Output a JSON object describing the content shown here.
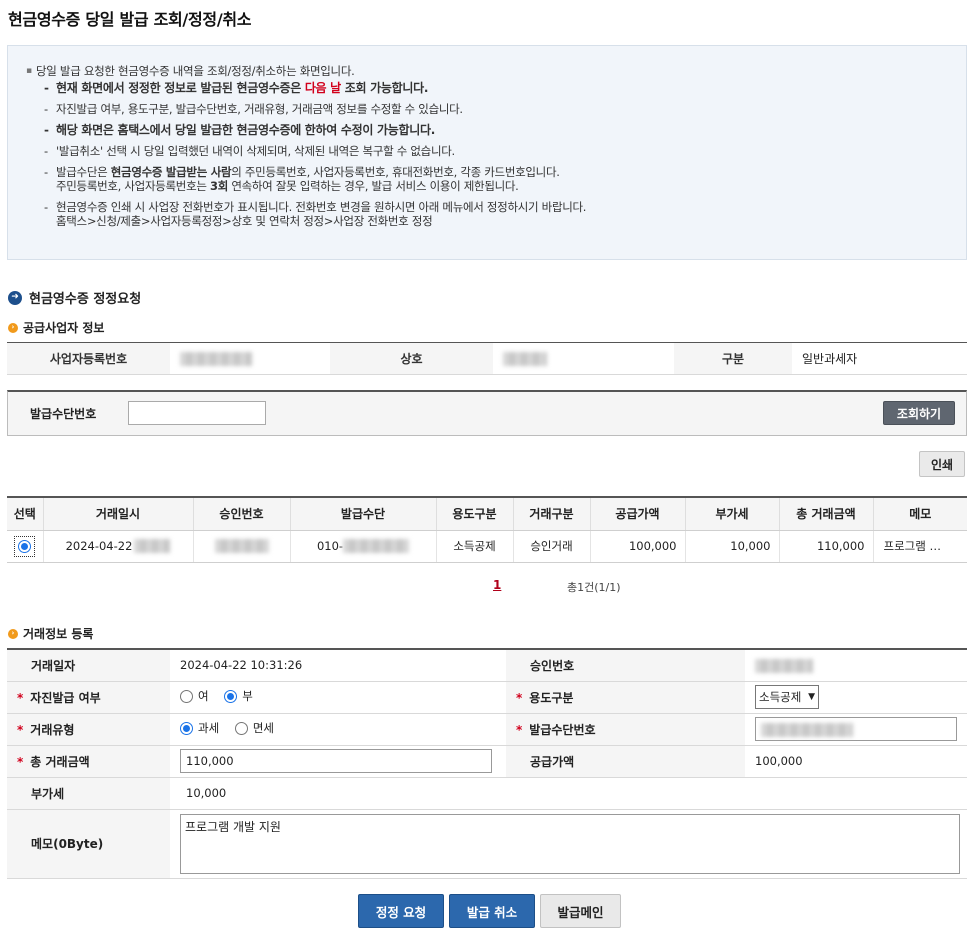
{
  "page": {
    "title": "현금영수증 당일 발급 조회/정정/취소"
  },
  "notice": {
    "intro": "당일 발급 요청한 현금영수증 내역을 조회/정정/취소하는 화면입니다.",
    "line1_a": "현재 화면에서 정정한 정보로 발급된 현금영수증은 ",
    "line1_b": "다음 날",
    "line1_c": " 조회 가능합니다.",
    "line2": "자진발급 여부, 용도구분, 발급수단번호, 거래유형, 거래금액 정보를 수정할 수 있습니다.",
    "line3": "해당 화면은 홈택스에서 당일 발급한 현금영수증에 한하여 수정이 가능합니다.",
    "line4": "'발급취소' 선택 시 당일 입력했던 내역이 삭제되며, 삭제된 내역은 복구할 수 없습니다.",
    "line5_a": "발급수단은 ",
    "line5_b": "현금영수증 발급받는 사람",
    "line5_c": "의 주민등록번호, 사업자등록번호, 휴대전화번호, 각종 카드번호입니다.",
    "line5_d": "주민등록번호, 사업자등록번호는 ",
    "line5_e": "3회",
    "line5_f": " 연속하여 잘못 입력하는 경우, 발급 서비스 이용이 제한됩니다.",
    "line6_a": "현금영수증 인쇄 시 사업장 전화번호가 표시됩니다. 전화번호 변경을 원하시면 아래 메뉴에서 정정하시기 바랍니다.",
    "line6_b": "홈택스>신청/제출>사업자등록정정>상호 및 연락처 정정>사업장 전화번호 정정"
  },
  "section": {
    "title": "현금영수증 정정요청"
  },
  "supplier": {
    "title": "공급사업자 정보",
    "biz_no_label": "사업자등록번호",
    "name_label": "상호",
    "type_label": "구분",
    "type_value": "일반과세자"
  },
  "search": {
    "label": "발급수단번호",
    "value": "",
    "button": "조회하기"
  },
  "print_button": "인쇄",
  "list": {
    "headers": [
      "선택",
      "거래일시",
      "승인번호",
      "발급수단",
      "용도구분",
      "거래구분",
      "공급가액",
      "부가세",
      "총 거래금액",
      "메모"
    ],
    "rows": [
      {
        "date": "2024-04-22",
        "method": "010-",
        "purpose": "소득공제",
        "trade": "승인거래",
        "supply": "100,000",
        "vat": "10,000",
        "total": "110,000",
        "memo": "프로그램 …"
      }
    ]
  },
  "pagination": {
    "current": "1",
    "total": "총1건(1/1)"
  },
  "form": {
    "title": "거래정보 등록",
    "date_label": "거래일자",
    "date_value": "2024-04-22 10:31:26",
    "approval_label": "승인번호",
    "self_label": "자진발급 여부",
    "self_yes": "여",
    "self_no": "부",
    "purpose_label": "용도구분",
    "purpose_value": "소득공제",
    "type_label": "거래유형",
    "type_tax": "과세",
    "type_free": "면세",
    "method_label": "발급수단번호",
    "total_label": "총 거래금액",
    "total_value": "110,000",
    "supply_label": "공급가액",
    "supply_value": "100,000",
    "vat_label": "부가세",
    "vat_value": "10,000",
    "memo_label": "메모(0Byte)",
    "memo_value": "프로그램 개발 지원"
  },
  "buttons": {
    "correct": "정정 요청",
    "cancel": "발급 취소",
    "mail": "발급메인"
  },
  "colors": {
    "primary": "#2c68ad",
    "dark_button": "#5f6670",
    "required": "#d1001c",
    "notice_bg": "#f1f5fa"
  }
}
